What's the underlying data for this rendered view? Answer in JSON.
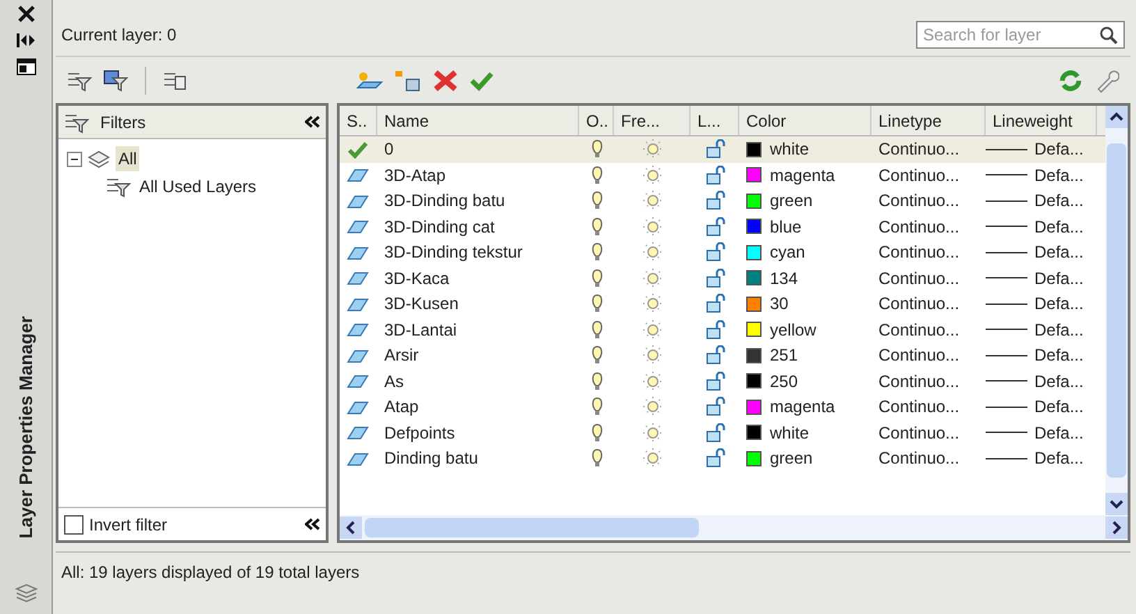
{
  "palette_title": "Layer Properties Manager",
  "current_layer": "Current layer: 0",
  "search": {
    "placeholder": "Search for layer"
  },
  "filters": {
    "header": "Filters",
    "tree": [
      {
        "label": "All",
        "expanded": true,
        "selected": true,
        "children": [
          {
            "label": "All Used Layers",
            "selected": false
          }
        ]
      }
    ],
    "invert_filter": {
      "label": "Invert filter",
      "checked": false
    }
  },
  "table": {
    "columns": [
      "S..",
      "Name",
      "O..",
      "Fre...",
      "L...",
      "Color",
      "Linetype",
      "Lineweight"
    ],
    "rows": [
      {
        "kind": "current",
        "name": "0",
        "on": true,
        "frozen": false,
        "locked": false,
        "color": "#000000",
        "color_name": "white",
        "linetype": "Continuo...",
        "lineweight": "Defa...",
        "selected": true
      },
      {
        "kind": "layer",
        "name": "3D-Atap",
        "on": true,
        "frozen": false,
        "locked": false,
        "color": "#ff00ff",
        "color_name": "magenta",
        "linetype": "Continuo...",
        "lineweight": "Defa...",
        "selected": false
      },
      {
        "kind": "layer",
        "name": "3D-Dinding batu",
        "on": true,
        "frozen": false,
        "locked": false,
        "color": "#00ff00",
        "color_name": "green",
        "linetype": "Continuo...",
        "lineweight": "Defa...",
        "selected": false
      },
      {
        "kind": "layer",
        "name": "3D-Dinding cat",
        "on": true,
        "frozen": false,
        "locked": false,
        "color": "#0000ff",
        "color_name": "blue",
        "linetype": "Continuo...",
        "lineweight": "Defa...",
        "selected": false
      },
      {
        "kind": "layer",
        "name": "3D-Dinding tekstur",
        "on": true,
        "frozen": false,
        "locked": false,
        "color": "#00ffff",
        "color_name": "cyan",
        "linetype": "Continuo...",
        "lineweight": "Defa...",
        "selected": false
      },
      {
        "kind": "layer",
        "name": "3D-Kaca",
        "on": true,
        "frozen": false,
        "locked": false,
        "color": "#008080",
        "color_name": "134",
        "linetype": "Continuo...",
        "lineweight": "Defa...",
        "selected": false
      },
      {
        "kind": "layer",
        "name": "3D-Kusen",
        "on": true,
        "frozen": false,
        "locked": false,
        "color": "#ff7f00",
        "color_name": "30",
        "linetype": "Continuo...",
        "lineweight": "Defa...",
        "selected": false
      },
      {
        "kind": "layer",
        "name": "3D-Lantai",
        "on": true,
        "frozen": false,
        "locked": false,
        "color": "#ffff00",
        "color_name": "yellow",
        "linetype": "Continuo...",
        "lineweight": "Defa...",
        "selected": false
      },
      {
        "kind": "layer",
        "name": "Arsir",
        "on": true,
        "frozen": false,
        "locked": false,
        "color": "#333333",
        "color_name": "251",
        "linetype": "Continuo...",
        "lineweight": "Defa...",
        "selected": false
      },
      {
        "kind": "layer",
        "name": "As",
        "on": true,
        "frozen": false,
        "locked": false,
        "color": "#000000",
        "color_name": "250",
        "linetype": "Continuo...",
        "lineweight": "Defa...",
        "selected": false
      },
      {
        "kind": "layer",
        "name": "Atap",
        "on": true,
        "frozen": false,
        "locked": false,
        "color": "#ff00ff",
        "color_name": "magenta",
        "linetype": "Continuo...",
        "lineweight": "Defa...",
        "selected": false
      },
      {
        "kind": "layer",
        "name": "Defpoints",
        "on": true,
        "frozen": false,
        "locked": false,
        "color": "#000000",
        "color_name": "white",
        "linetype": "Continuo...",
        "lineweight": "Defa...",
        "selected": false
      },
      {
        "kind": "layer",
        "name": "Dinding batu",
        "on": true,
        "frozen": false,
        "locked": false,
        "color": "#00ff00",
        "color_name": "green",
        "linetype": "Continuo...",
        "lineweight": "Defa...",
        "selected": false
      }
    ]
  },
  "status_bar": "All: 19 layers displayed of 19 total layers"
}
